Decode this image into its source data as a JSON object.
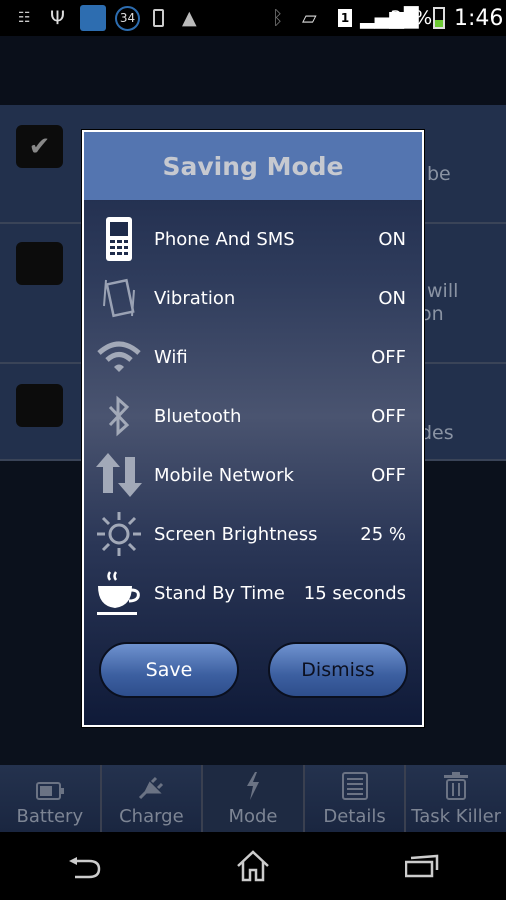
{
  "status_bar": {
    "battery": "34%",
    "time": "1:46",
    "notification_count": "34",
    "colors": {
      "charging": "#6cc833"
    }
  },
  "background_list": {
    "fragments": [
      "be",
      "will",
      "on",
      "des"
    ],
    "rows": [
      {
        "checked": true
      },
      {
        "checked": false
      },
      {
        "checked": false
      }
    ]
  },
  "dialog": {
    "title": "Saving Mode",
    "items": [
      {
        "icon": "phone-icon",
        "label": "Phone And SMS",
        "value": "ON"
      },
      {
        "icon": "vibration-icon",
        "label": "Vibration",
        "value": "ON"
      },
      {
        "icon": "wifi-icon",
        "label": "Wifi",
        "value": "OFF"
      },
      {
        "icon": "bluetooth-icon",
        "label": "Bluetooth",
        "value": "OFF"
      },
      {
        "icon": "mobile-network-icon",
        "label": "Mobile Network",
        "value": "OFF"
      },
      {
        "icon": "brightness-icon",
        "label": "Screen Brightness",
        "value": "25 %"
      },
      {
        "icon": "coffee-cup-icon",
        "label": "Stand By Time",
        "value": "15 seconds"
      }
    ],
    "save_label": "Save",
    "dismiss_label": "Dismiss",
    "colors": {
      "title_bg": "#5475b0",
      "button": "#4a6db0"
    }
  },
  "tabs": [
    {
      "label": "Battery"
    },
    {
      "label": "Charge"
    },
    {
      "label": "Mode",
      "active": true
    },
    {
      "label": "Details"
    },
    {
      "label": "Task Killer"
    }
  ]
}
